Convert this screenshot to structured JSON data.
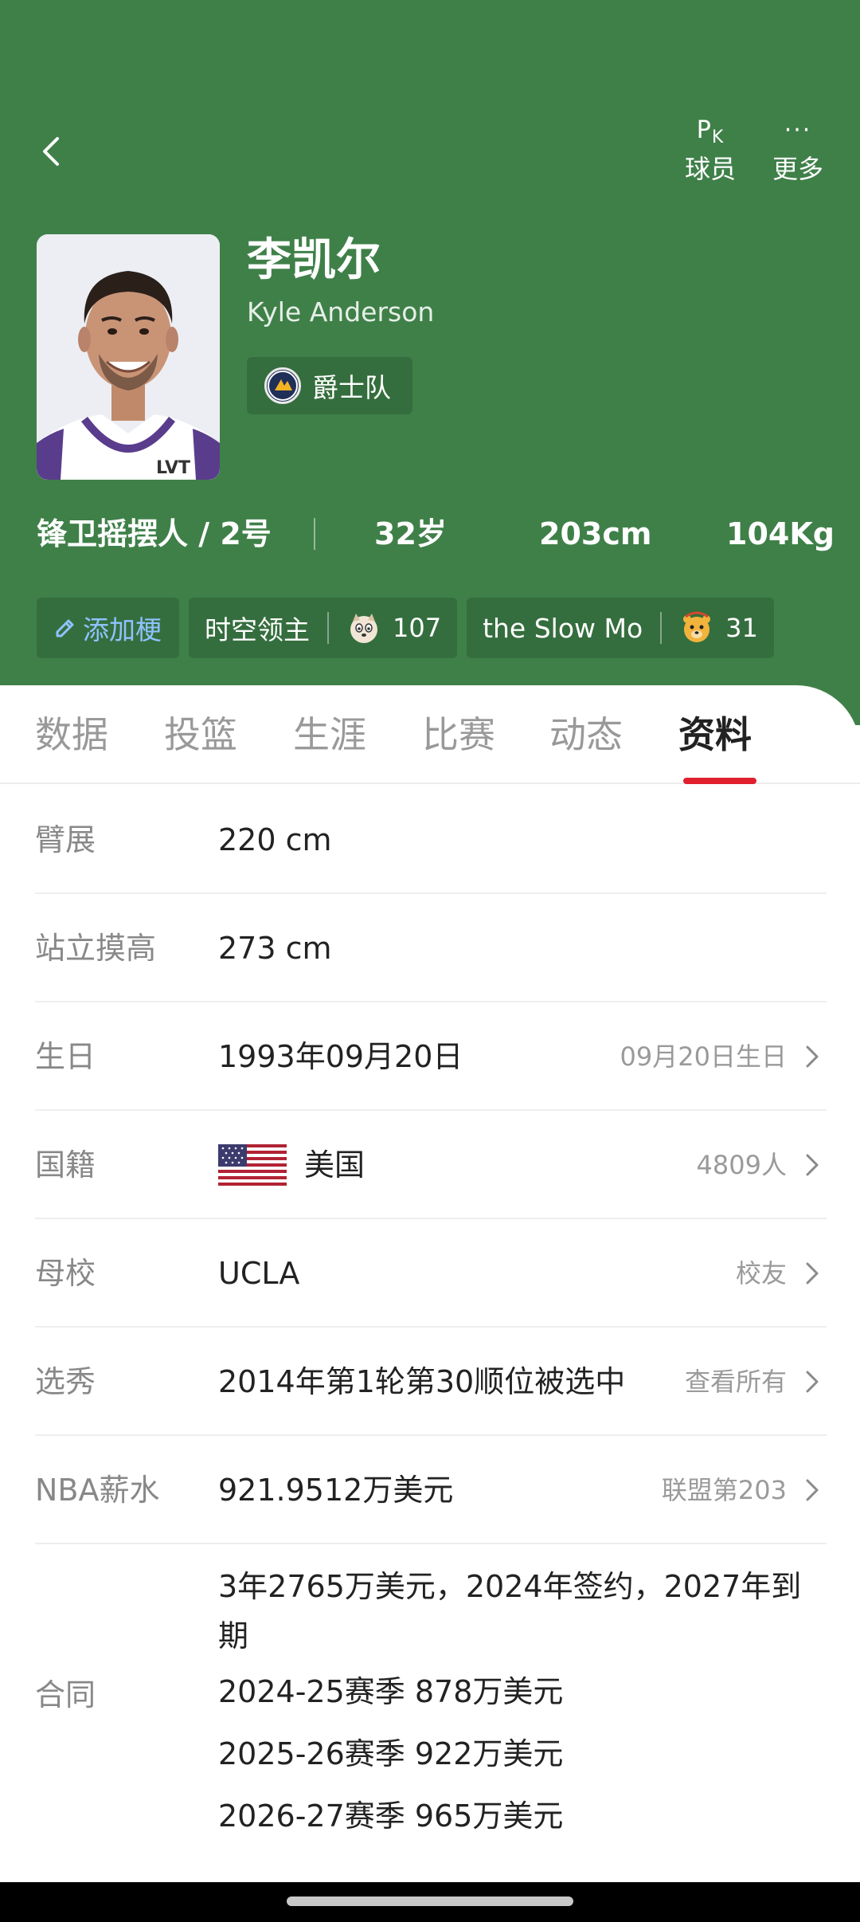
{
  "header": {
    "pk_label": "球员",
    "pk_glyph_main": "P",
    "pk_glyph_sub": "K",
    "more_label": "更多",
    "player": {
      "name_cn": "李凯尔",
      "name_en": "Kyle Anderson",
      "team": "爵士队",
      "jersey_text": "LVT"
    },
    "stats": {
      "position_number": "锋卫摇摆人 / 2号",
      "age": "32岁",
      "height": "203cm",
      "weight": "104Kg"
    },
    "chips": {
      "add": "添加梗",
      "tags": [
        {
          "label": "时空领主",
          "count": "107"
        },
        {
          "label": "the Slow Mo",
          "count": "31"
        }
      ]
    }
  },
  "tabs": [
    {
      "label": "数据",
      "active": false
    },
    {
      "label": "投篮",
      "active": false
    },
    {
      "label": "生涯",
      "active": false
    },
    {
      "label": "比赛",
      "active": false
    },
    {
      "label": "动态",
      "active": false
    },
    {
      "label": "资料",
      "active": true
    }
  ],
  "info": {
    "wingspan": {
      "label": "臂展",
      "value": "220 cm"
    },
    "reach": {
      "label": "站立摸高",
      "value": "273 cm"
    },
    "birthday": {
      "label": "生日",
      "value": "1993年09月20日",
      "action": "09月20日生日"
    },
    "nationality": {
      "label": "国籍",
      "value": "美国",
      "action": "4809人"
    },
    "college": {
      "label": "母校",
      "value": "UCLA",
      "action": "校友"
    },
    "draft": {
      "label": "选秀",
      "value": "2014年第1轮第30顺位被选中",
      "action": "查看所有"
    },
    "salary": {
      "label": "NBA薪水",
      "value": "921.9512万美元",
      "action": "联盟第203"
    },
    "contract": {
      "label": "合同",
      "summary_line1": "3年2765万美元，2024年签约，2027年到",
      "summary_line2": "期",
      "seasons": [
        "2024-25赛季 878万美元",
        "2025-26赛季 922万美元",
        "2026-27赛季 965万美元"
      ]
    }
  },
  "colors": {
    "header_green": "#3f8049",
    "chip_bg": "#356e3e",
    "tab_indicator": "#e0202f",
    "add_chip_text": "#8fc3ff"
  }
}
